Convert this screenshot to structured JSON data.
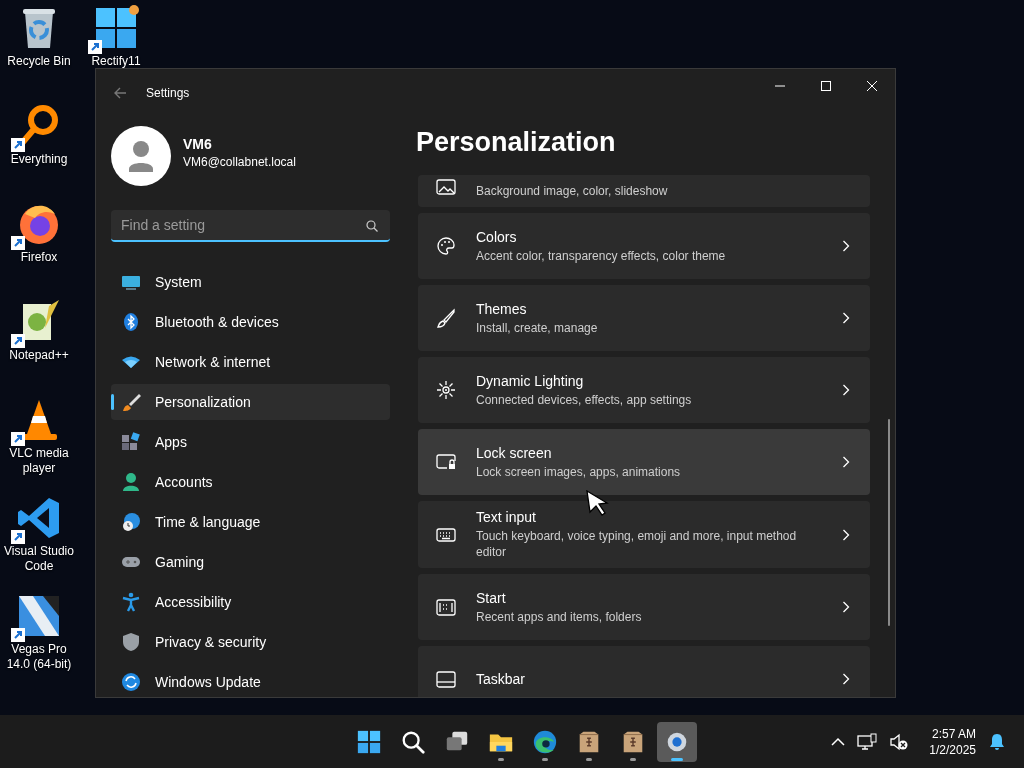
{
  "desktop": {
    "icons": [
      {
        "label": "Recycle Bin",
        "kind": "recycle",
        "shortcut": false
      },
      {
        "label": "Rectify11",
        "kind": "rectify",
        "shortcut": true
      },
      {
        "label": "Everything",
        "kind": "everything",
        "shortcut": true
      },
      {
        "label": "Firefox",
        "kind": "firefox",
        "shortcut": true
      },
      {
        "label": "Notepad++",
        "kind": "notepad",
        "shortcut": true
      },
      {
        "label": "VLC media player",
        "kind": "vlc",
        "shortcut": true
      },
      {
        "label": "Visual Studio Code",
        "kind": "vscode",
        "shortcut": true
      },
      {
        "label": "Vegas Pro 14.0 (64-bit)",
        "kind": "vegas",
        "shortcut": true
      }
    ]
  },
  "window": {
    "title": "Settings",
    "account": {
      "name": "VM6",
      "email": "VM6@collabnet.local"
    },
    "search": {
      "placeholder": "Find a setting"
    },
    "nav": [
      {
        "label": "System",
        "selected": false
      },
      {
        "label": "Bluetooth & devices",
        "selected": false
      },
      {
        "label": "Network & internet",
        "selected": false
      },
      {
        "label": "Personalization",
        "selected": true
      },
      {
        "label": "Apps",
        "selected": false
      },
      {
        "label": "Accounts",
        "selected": false
      },
      {
        "label": "Time & language",
        "selected": false
      },
      {
        "label": "Gaming",
        "selected": false
      },
      {
        "label": "Accessibility",
        "selected": false
      },
      {
        "label": "Privacy & security",
        "selected": false
      },
      {
        "label": "Windows Update",
        "selected": false
      }
    ],
    "heading": "Personalization",
    "cards": [
      {
        "kind": "partial",
        "subtitle": "Background image, color, slideshow",
        "hovered": false
      },
      {
        "kind": "full",
        "title": "Colors",
        "subtitle": "Accent color, transparency effects, color theme",
        "hovered": false
      },
      {
        "kind": "full",
        "title": "Themes",
        "subtitle": "Install, create, manage",
        "hovered": false
      },
      {
        "kind": "full",
        "title": "Dynamic Lighting",
        "subtitle": "Connected devices, effects, app settings",
        "hovered": false
      },
      {
        "kind": "full",
        "title": "Lock screen",
        "subtitle": "Lock screen images, apps, animations",
        "hovered": true
      },
      {
        "kind": "full",
        "title": "Text input",
        "subtitle": "Touch keyboard, voice typing, emoji and more, input method editor",
        "hovered": false
      },
      {
        "kind": "full",
        "title": "Start",
        "subtitle": "Recent apps and items, folders",
        "hovered": false
      },
      {
        "kind": "full",
        "title": "Taskbar",
        "hovered": false
      }
    ]
  },
  "taskbar": {
    "apps": [
      {
        "kind": "start",
        "running": false,
        "selected": false
      },
      {
        "kind": "search",
        "running": false,
        "selected": false
      },
      {
        "kind": "taskview",
        "running": false,
        "selected": false
      },
      {
        "kind": "explorer",
        "running": true,
        "selected": false
      },
      {
        "kind": "edge",
        "running": true,
        "selected": false
      },
      {
        "kind": "package",
        "running": true,
        "selected": false
      },
      {
        "kind": "package",
        "running": true,
        "selected": false
      },
      {
        "kind": "settings",
        "running": true,
        "selected": true
      }
    ],
    "tray": {
      "time": "2:57 AM",
      "date": "1/2/2025"
    }
  }
}
